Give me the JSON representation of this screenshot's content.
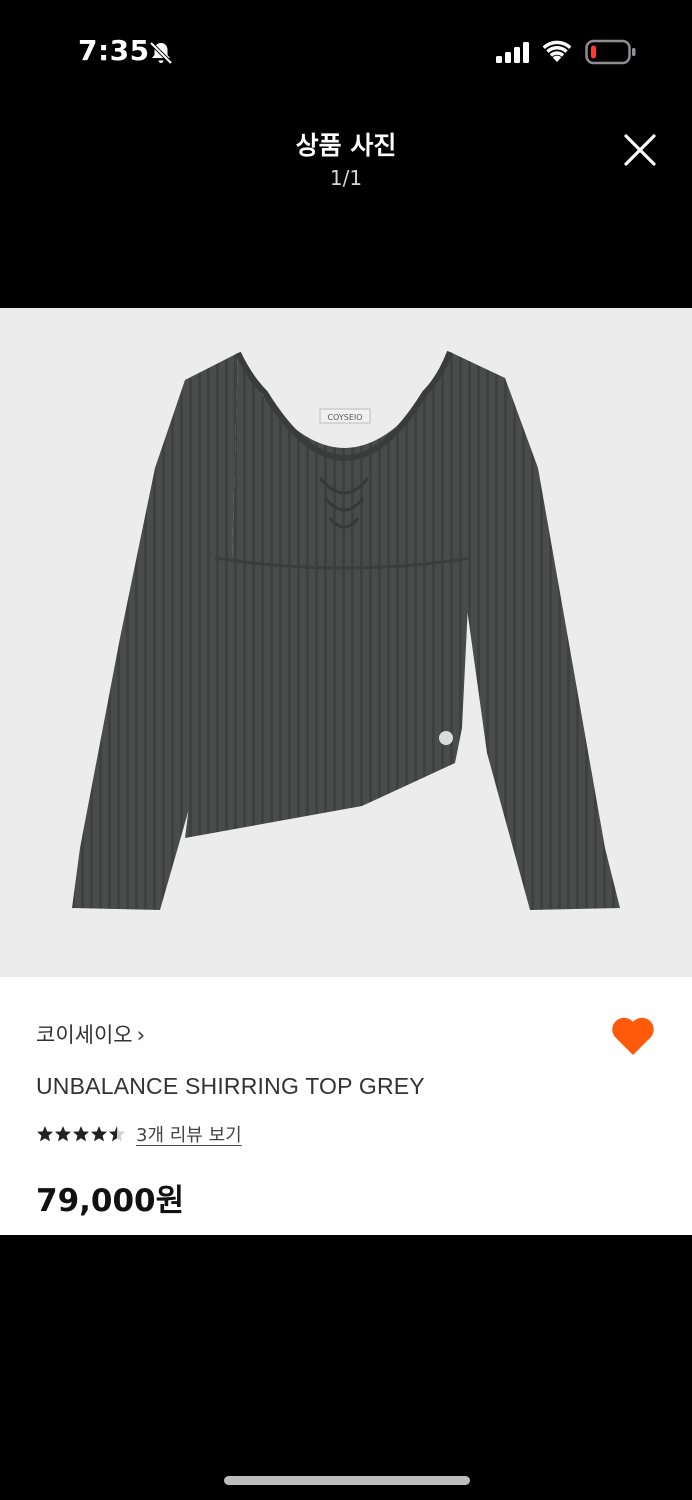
{
  "status_bar": {
    "time": "7:35",
    "icons": [
      "bell-slash-icon",
      "signal-icon",
      "wifi-icon",
      "battery-icon"
    ],
    "battery_color": "#ff3b30"
  },
  "header": {
    "title": "상품 사진",
    "counter": "1/1",
    "close_icon": "close-icon"
  },
  "product": {
    "image_label": "COYSEIO",
    "brand": "코이세이오",
    "brand_chevron": "›",
    "name": "UNBALANCE SHIRRING TOP GREY",
    "rating": 4.5,
    "rating_max": 5,
    "review_link": "3개 리뷰 보기",
    "price": "79,000원",
    "wishlisted": true,
    "heart_color": "#ff5a0a"
  }
}
